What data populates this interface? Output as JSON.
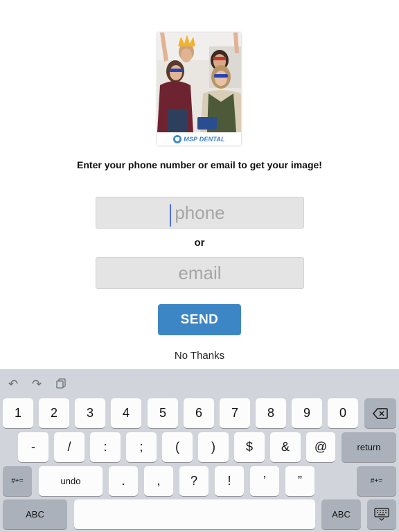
{
  "photo": {
    "brand_text": "MSP DENTAL"
  },
  "prompt_text": "Enter your phone number or email to get your image!",
  "phone_field": {
    "placeholder": "phone",
    "value": ""
  },
  "or_text": "or",
  "email_field": {
    "placeholder": "email",
    "value": ""
  },
  "send_label": "SEND",
  "no_thanks_label": "No Thanks",
  "keyboard": {
    "toolbar": {
      "undo_icon": "undo-arrow-icon",
      "redo_icon": "redo-arrow-icon",
      "paste_icon": "paste-icon"
    },
    "row1": [
      "1",
      "2",
      "3",
      "4",
      "5",
      "6",
      "7",
      "8",
      "9",
      "0"
    ],
    "backspace_icon": "backspace-icon",
    "row2": [
      "-",
      "/",
      ":",
      ";",
      "(",
      ")",
      "$",
      "&",
      "@"
    ],
    "return_label": "return",
    "row3_left_label": "#+=",
    "undo_label": "undo",
    "row3": [
      ".",
      ",",
      "?",
      "!",
      "’",
      "”"
    ],
    "row3_right_label": "#+=",
    "abc_left_label": "ABC",
    "space_label": "",
    "abc_right_label": "ABC",
    "dismiss_icon": "keyboard-dismiss-icon"
  }
}
